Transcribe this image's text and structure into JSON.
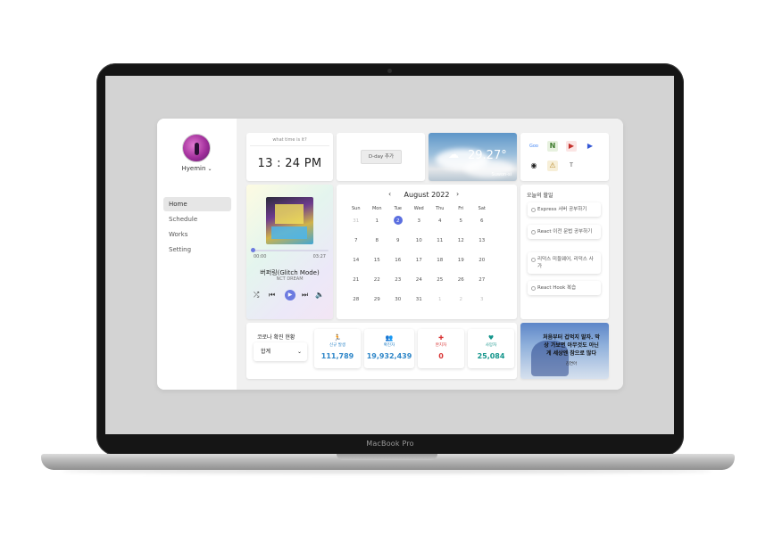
{
  "device": {
    "brand_label": "MacBook Pro"
  },
  "sidebar": {
    "user_name": "Hyemin",
    "nav_items": [
      {
        "label": "Home",
        "active": true
      },
      {
        "label": "Schedule",
        "active": false
      },
      {
        "label": "Works",
        "active": false
      },
      {
        "label": "Setting",
        "active": false
      }
    ]
  },
  "clock": {
    "question": "what time is it?",
    "time": "13 : 24 PM"
  },
  "dday": {
    "button_label": "D-day 추가"
  },
  "weather": {
    "temperature": "29.27°",
    "city": "Suwon-si",
    "icon": "cloud-icon"
  },
  "shortcuts": {
    "items": [
      {
        "label": "Goo",
        "icon": "google-icon",
        "color": "#4285f4"
      },
      {
        "label": "N",
        "icon": "notion-icon",
        "color": "#5aa246"
      },
      {
        "label": "▶",
        "icon": "youtube-icon",
        "color": "#c4302b"
      },
      {
        "label": "▶",
        "icon": "play-store-icon",
        "color": "#3457d5"
      },
      {
        "label": "◉",
        "icon": "github-icon",
        "color": "#222222"
      },
      {
        "label": "⚠",
        "icon": "alert-icon",
        "color": "#b88a2c"
      },
      {
        "label": "T",
        "icon": "tistory-icon",
        "color": "#333333"
      }
    ]
  },
  "music": {
    "current_time": "00:00",
    "duration": "03:27",
    "progress": 0.01,
    "title": "버퍼링(Glitch Mode)",
    "artist": "NCT DREAM"
  },
  "calendar": {
    "month_label": "August 2022",
    "weekdays": [
      "Sun",
      "Mon",
      "Tue",
      "Wed",
      "Thu",
      "Fri",
      "Sat"
    ],
    "weeks": [
      [
        "31",
        "1",
        "2",
        "3",
        "4",
        "5",
        "6"
      ],
      [
        "7",
        "8",
        "9",
        "10",
        "11",
        "12",
        "13"
      ],
      [
        "14",
        "15",
        "16",
        "17",
        "18",
        "19",
        "20"
      ],
      [
        "21",
        "22",
        "23",
        "24",
        "25",
        "26",
        "27"
      ],
      [
        "28",
        "29",
        "30",
        "31",
        "1",
        "2",
        "3"
      ]
    ],
    "today": "2"
  },
  "todo": {
    "title": "오늘의 할일",
    "items": [
      "Express 서버 공부하기",
      "React 이전 문법 공부하기",
      "리덕스 미들웨어, 리덕스 사가",
      "React Hook 복습"
    ]
  },
  "covid": {
    "label": "코로나 확진 현황",
    "select_value": "합계",
    "stats": [
      {
        "label": "신규 발생",
        "value": "111,789",
        "icon": "person-run-icon",
        "color": "#2e86c8"
      },
      {
        "label": "확진자",
        "value": "19,932,439",
        "icon": "people-icon",
        "color": "#2e86c8"
      },
      {
        "label": "완치자",
        "value": "0",
        "icon": "medical-cross-icon",
        "color": "#d93434"
      },
      {
        "label": "사망자",
        "value": "25,084",
        "icon": "heart-pulse-icon",
        "color": "#13958b"
      }
    ]
  },
  "quote": {
    "text": "처음부터 겁먹지 말자. 막상 가보면 아무것도 아닌게 세상엔 참으로 많다",
    "author": "김연아"
  }
}
